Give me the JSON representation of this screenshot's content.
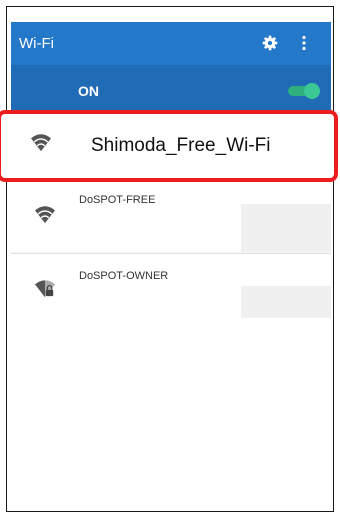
{
  "appbar": {
    "title": "Wi-Fi",
    "settings_icon": "gear-icon",
    "more_icon": "more-vert-icon"
  },
  "wifi_toggle": {
    "label": "ON",
    "enabled": true
  },
  "networks": [
    {
      "name": "Shimoda_Free_Wi-Fi",
      "icon": "wifi-icon",
      "secured": false,
      "highlighted": true
    },
    {
      "name": "DoSPOT-FREE",
      "icon": "wifi-icon",
      "secured": false
    },
    {
      "name": "DoSPOT-OWNER",
      "icon": "wifi-lock-icon",
      "secured": true
    }
  ],
  "colors": {
    "appbar": "#2478c9",
    "toggle_bar": "#1f6bb5",
    "switch_on": "#3cc894",
    "highlight_border": "#ee1d1d"
  }
}
